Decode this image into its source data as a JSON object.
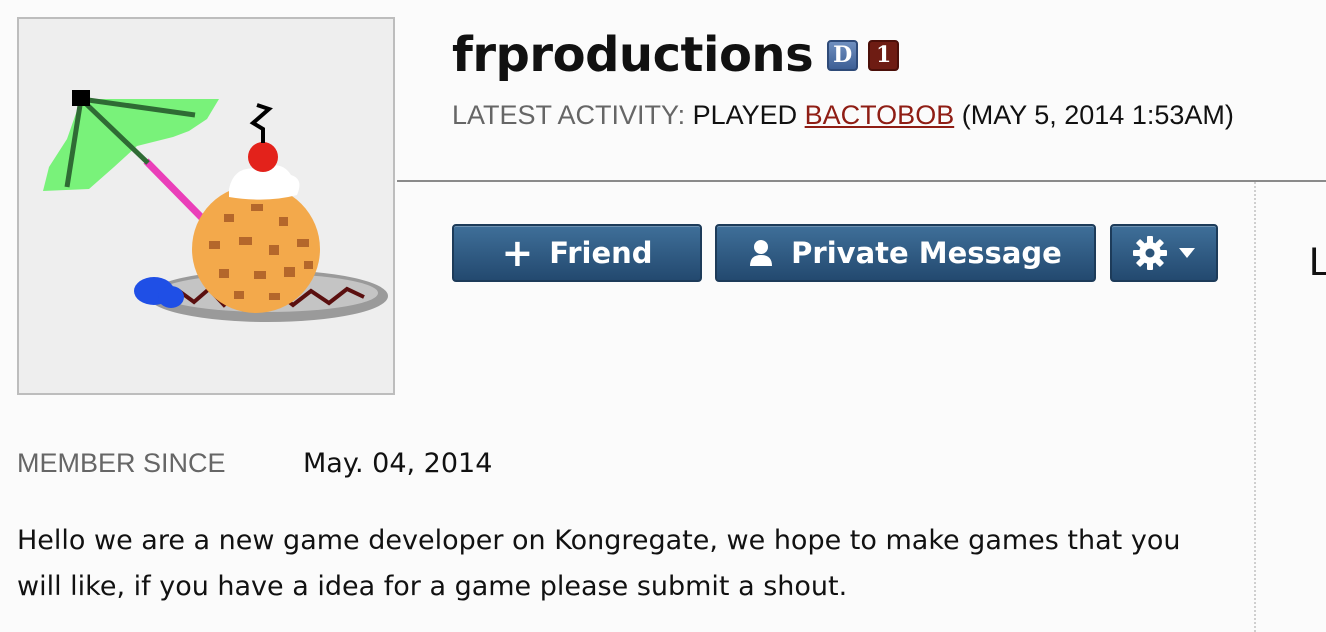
{
  "profile": {
    "username": "frproductions",
    "badges": {
      "developer": "D",
      "level": "1"
    },
    "activity": {
      "label": "LATEST ACTIVITY:",
      "prefix": "PLAYED",
      "game": "BACTOBOB",
      "timestamp": "(MAY 5, 2014 1:53AM)"
    },
    "member_since": {
      "label": "MEMBER SINCE",
      "value": "May. 04, 2014"
    },
    "about": "Hello we are a new game developer on Kongregate, we hope to make games that you will like, if you have a idea for a game please submit a shout."
  },
  "actions": {
    "friend_label": "Friend",
    "private_message_label": "Private Message"
  },
  "icons": {
    "friend": "plus-icon",
    "private_message": "person-icon",
    "settings": "gear-icon",
    "settings_menu": "caret-down-icon"
  },
  "colors": {
    "button_bg": "#2f5a82",
    "link": "#8f1d14",
    "dev_badge": "#4a6ea6",
    "level_badge": "#6e1c13"
  },
  "right_panel": {
    "cutoff_text": "L"
  }
}
